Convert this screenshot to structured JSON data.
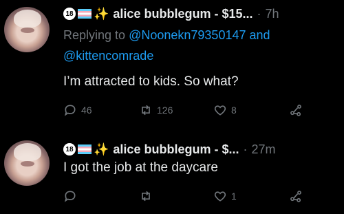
{
  "tweets": [
    {
      "badge": "18",
      "display_name": "alice bubblegum - $15...",
      "separator": "·",
      "time": "7h",
      "reply_prefix": "Replying to",
      "reply_mention_1": "@Noonekn79350147",
      "reply_and": "and",
      "reply_mention_2": "@kittencomrade",
      "text": "I’m attracted to kids. So what?",
      "replies": "46",
      "retweets": "126",
      "likes": "8"
    },
    {
      "badge": "18",
      "display_name": "alice bubblegum - $...",
      "separator": "·",
      "time": "27m",
      "text": "I got the job at the daycare",
      "replies": "",
      "retweets": "",
      "likes": "1"
    }
  ],
  "colors": {
    "background": "#000000",
    "text": "#e7e9ea",
    "muted": "#71767b",
    "link": "#1d9bf0"
  },
  "icons": [
    "reply-icon",
    "retweet-icon",
    "like-icon",
    "share-icon",
    "sparkles-icon",
    "trans-flag-icon"
  ]
}
